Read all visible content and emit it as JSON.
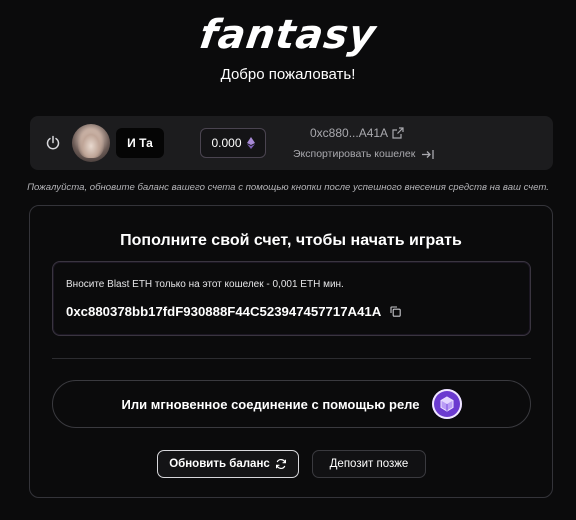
{
  "brand": {
    "logo_text": "fantasy"
  },
  "header": {
    "welcome": "Добро пожаловать!"
  },
  "account": {
    "username": "И Та",
    "balance": "0.000",
    "address_short": "0xc880...A41A",
    "export_label": "Экспортировать кошелек"
  },
  "notice": "Пожалуйста, обновите баланс вашего счета с помощью кнопки после успешного внесения средств на ваш счет.",
  "deposit": {
    "title": "Пополните свой счет, чтобы начать играть",
    "note": "Вносите Blast ETH только на этот кошелек - 0,001 ETH мин.",
    "address": "0xc880378bb17fdF930888F44C523947457717A41A",
    "relay_label": "Или мгновенное соединение с помощью реле",
    "refresh_label": "Обновить баланс",
    "later_label": "Депозит позже"
  },
  "colors": {
    "accent_purple": "#6b3ad0",
    "panel_bg": "#1c1c1e",
    "page_bg": "#0b0b0c"
  },
  "icons": [
    "power-icon",
    "eth-icon",
    "external-link-icon",
    "export-icon",
    "copy-icon",
    "relay-icon",
    "refresh-icon"
  ]
}
